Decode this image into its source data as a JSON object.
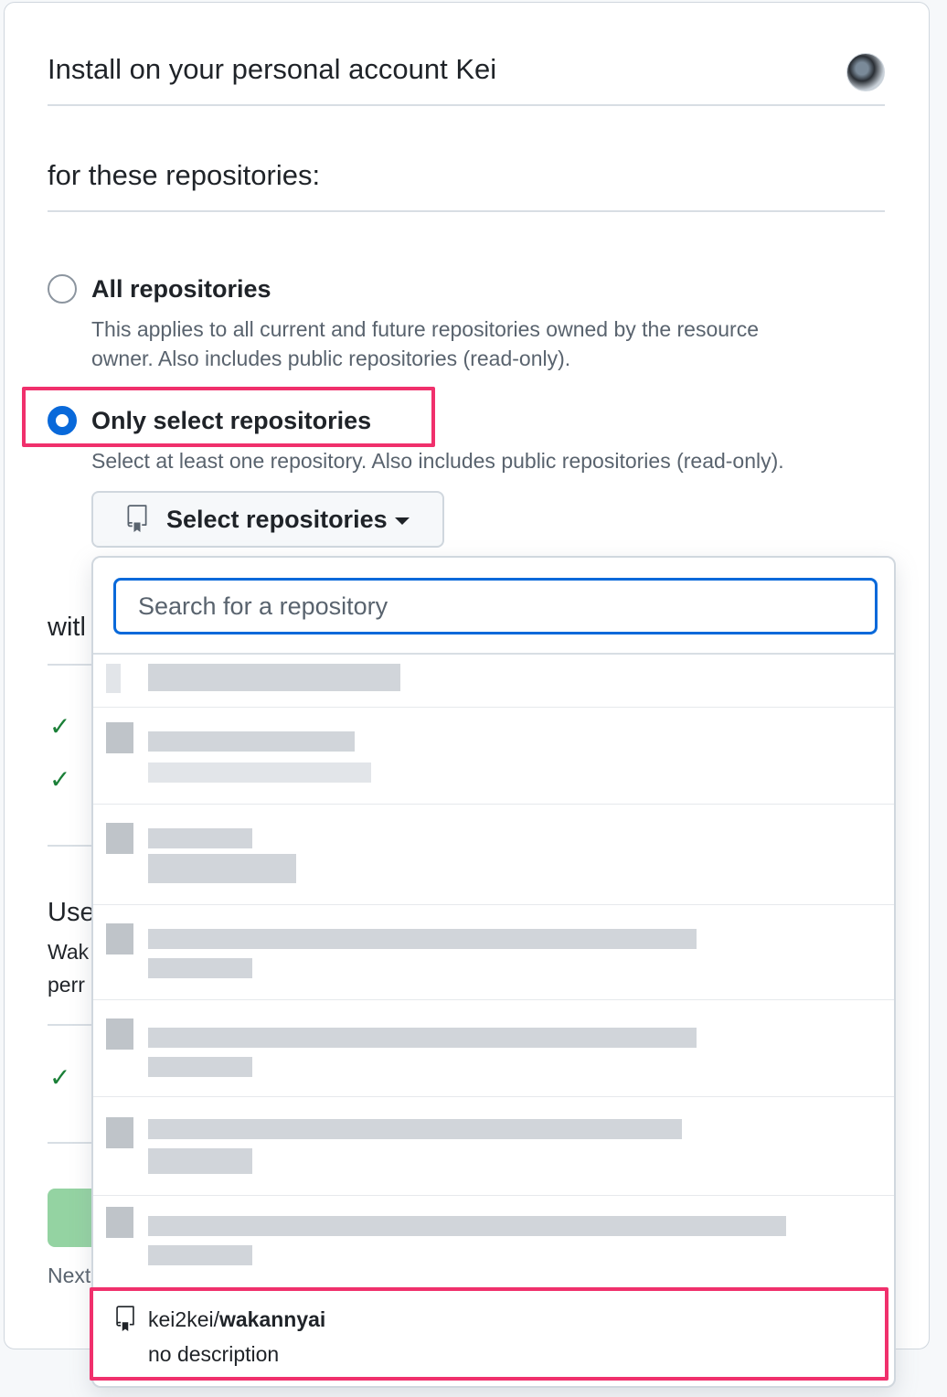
{
  "install": {
    "title": "Install on your personal account Kei"
  },
  "repositories_section": {
    "title": "for these repositories:"
  },
  "options": {
    "all": {
      "label": "All repositories",
      "description_line1": "This applies to all current and future repositories owned by the resource",
      "description_line2": "owner. Also includes public repositories (read-only)."
    },
    "only_select": {
      "label": "Only select repositories",
      "description": "Select at least one repository. Also includes public repositories (read-only)."
    }
  },
  "select_button": {
    "label": "Select repositories"
  },
  "search": {
    "placeholder": "Search for a repository"
  },
  "background": {
    "with_heading": "witl",
    "user_heading": "Use",
    "user_line1": "Wak",
    "user_line2": "perr",
    "next_text": "Next"
  },
  "selected_repo": {
    "owner": "kei2kei/",
    "name": "wakannyai",
    "description": "no description"
  },
  "colors": {
    "accent": "#0969da",
    "highlight": "#f0306c",
    "success": "#1a7f37"
  }
}
